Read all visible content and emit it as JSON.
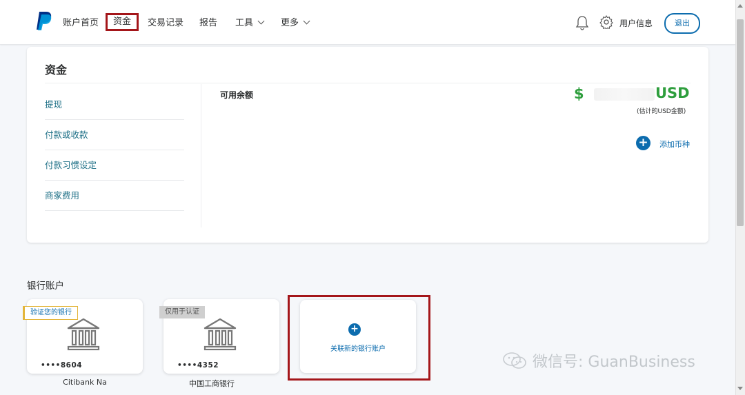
{
  "nav": {
    "items": [
      {
        "label": "账户首页"
      },
      {
        "label": "资金"
      },
      {
        "label": "交易记录"
      },
      {
        "label": "报告"
      },
      {
        "label": "工具"
      },
      {
        "label": "更多"
      }
    ],
    "user_info": "用户信息",
    "logout": "退出",
    "icons": [
      "paypal-logo",
      "bell-icon",
      "gear-icon"
    ]
  },
  "funds": {
    "title": "资金",
    "sidebar": [
      {
        "label": "提现"
      },
      {
        "label": "付款或收款"
      },
      {
        "label": "付款习惯设定"
      },
      {
        "label": "商家费用"
      }
    ],
    "available_label": "可用余额",
    "currency_symbol": "$",
    "currency_code": "USD",
    "estimate_note": "(估计的USD金额)",
    "add_currency": "添加币种"
  },
  "banks": {
    "title": "银行账户",
    "accounts": [
      {
        "tag": "验证您的银行",
        "mask": "••••8604",
        "name": "Citibank Na"
      },
      {
        "tag": "仅用于认证",
        "mask": "••••4352",
        "name": "中国工商银行"
      }
    ],
    "add_label": "关联新的银行账户"
  },
  "watermark": "微信号: GuanBusiness",
  "colors": {
    "brand_blue": "#0c6cae",
    "balance_green": "#2e9e3d",
    "highlight_red": "#a4161a",
    "link_teal": "#1d6f86"
  }
}
